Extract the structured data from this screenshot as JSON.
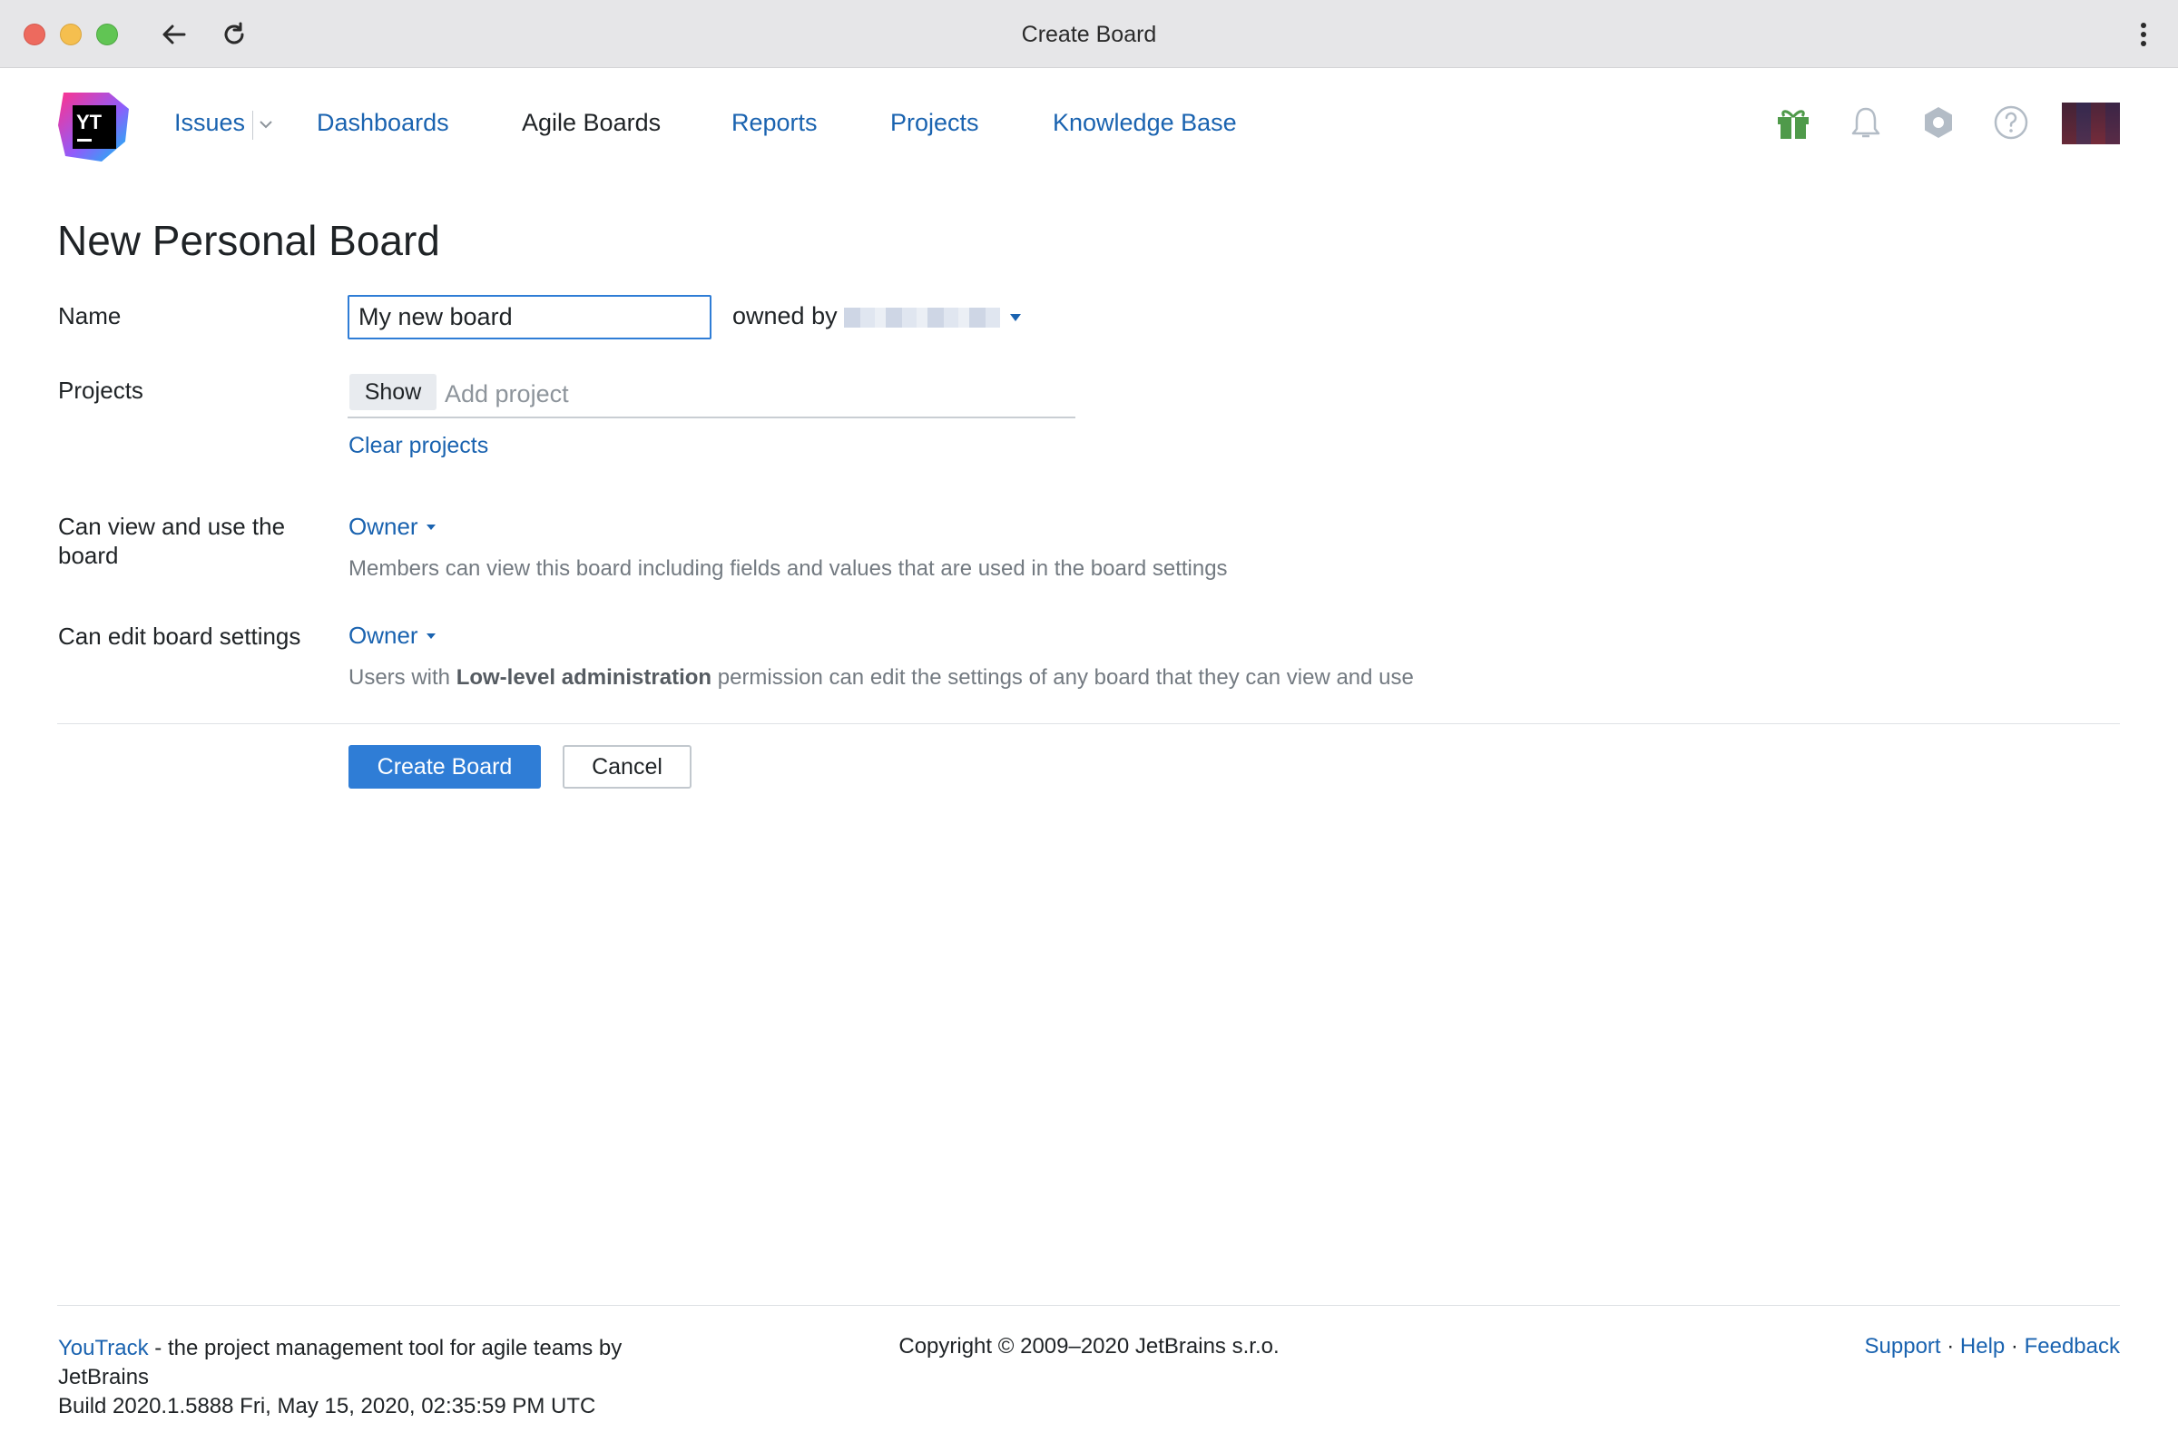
{
  "window": {
    "title": "Create Board"
  },
  "nav": {
    "issues": "Issues",
    "dashboards": "Dashboards",
    "agile_boards": "Agile Boards",
    "reports": "Reports",
    "projects": "Projects",
    "knowledge_base": "Knowledge Base"
  },
  "header_icons": [
    "gift-icon",
    "bell-icon",
    "settings-icon",
    "help-icon"
  ],
  "colors": {
    "link": "#1a63b0",
    "primary": "#2f7dd6",
    "gift": "#4f9a4a"
  },
  "form": {
    "title": "New Personal Board",
    "name_label": "Name",
    "name_value": "My new board",
    "owned_by": "owned by",
    "projects_label": "Projects",
    "show_button": "Show",
    "add_project_placeholder": "Add project",
    "clear_projects": "Clear projects",
    "view_label": "Can view and use the board",
    "view_value": "Owner",
    "view_hint": "Members can view this board including fields and values that are used in the board settings",
    "edit_label": "Can edit board settings",
    "edit_value": "Owner",
    "edit_hint_prefix": "Users with ",
    "edit_hint_bold": "Low-level administration",
    "edit_hint_suffix": " permission can edit the settings of any board that they can view and use",
    "create_button": "Create Board",
    "cancel_button": "Cancel"
  },
  "footer": {
    "youtrack": "YouTrack",
    "tagline": " - the project management tool for agile teams by JetBrains",
    "build": "Build 2020.1.5888 Fri, May 15, 2020, 02:35:59 PM UTC",
    "copyright": "Copyright © 2009–2020 JetBrains s.r.o.",
    "support": "Support",
    "help": "Help",
    "feedback": "Feedback",
    "sep": " · "
  }
}
